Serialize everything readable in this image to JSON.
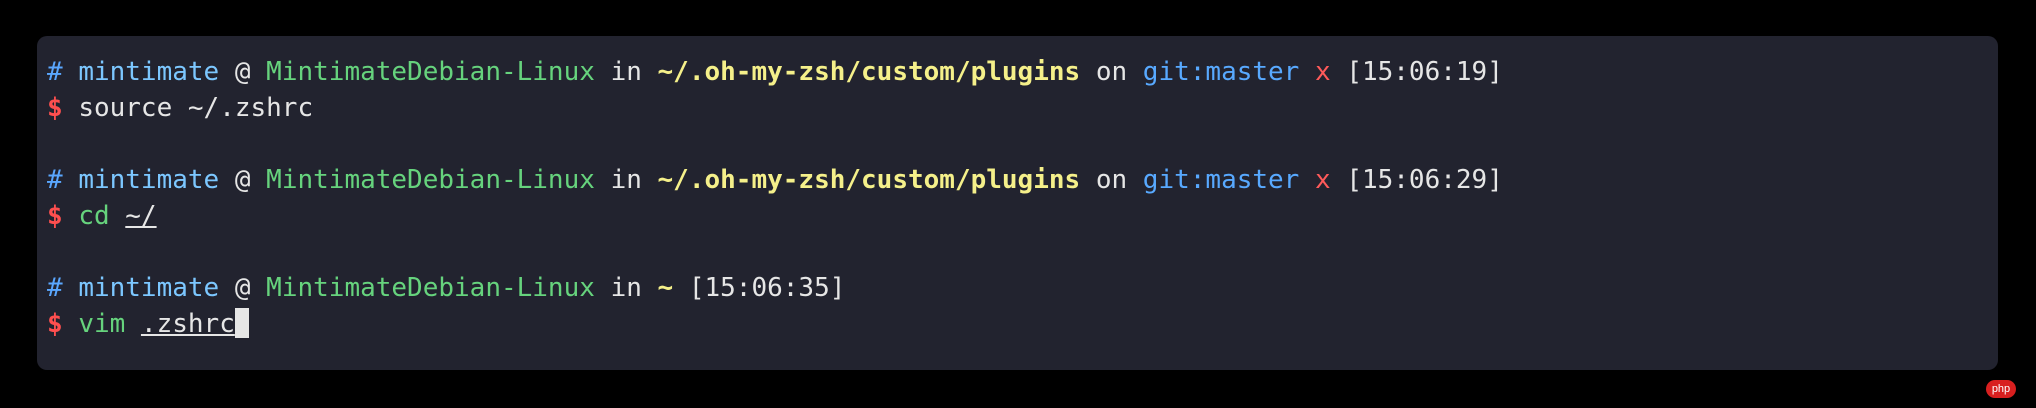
{
  "terminal": {
    "blocks": [
      {
        "prompt": {
          "hash": "#",
          "user": "mintimate",
          "at": "@",
          "host": "MintimateDebian-Linux",
          "in": "in",
          "path": "~/.oh-my-zsh/custom/plugins",
          "on": "on",
          "git": "git:master",
          "x": "x",
          "time": "[15:06:19]"
        },
        "command": {
          "dollar": "$",
          "cmd": "source",
          "arg": "~/.zshrc"
        }
      },
      {
        "prompt": {
          "hash": "#",
          "user": "mintimate",
          "at": "@",
          "host": "MintimateDebian-Linux",
          "in": "in",
          "path": "~/.oh-my-zsh/custom/plugins",
          "on": "on",
          "git": "git:master",
          "x": "x",
          "time": "[15:06:29]"
        },
        "command": {
          "dollar": "$",
          "cmd": "cd",
          "arg": "~/"
        }
      },
      {
        "prompt": {
          "hash": "#",
          "user": "mintimate",
          "at": "@",
          "host": "MintimateDebian-Linux",
          "in": "in",
          "path": "~",
          "time": "[15:06:35]"
        },
        "command": {
          "dollar": "$",
          "cmd": "vim",
          "arg": ".zshrc"
        }
      }
    ]
  },
  "watermark": {
    "text": "php"
  }
}
